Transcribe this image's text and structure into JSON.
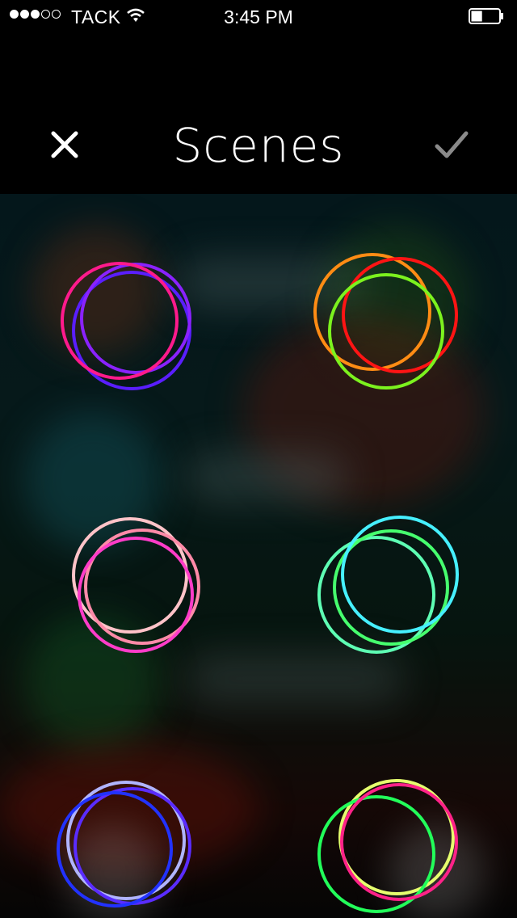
{
  "status_bar": {
    "carrier": "TACK",
    "time": "3:45 PM",
    "signal_bars_filled": 3,
    "signal_bars_total": 5,
    "battery_level": 0.4,
    "wifi_icon": "wifi-icon",
    "battery_icon": "battery-icon"
  },
  "nav": {
    "title": "Scenes",
    "close_icon": "close-icon",
    "confirm_icon": "checkmark-icon"
  },
  "scenes": [
    {
      "id": "scene-1",
      "colors": [
        "#5a1eff",
        "#8a22ff",
        "#ff1a8c"
      ]
    },
    {
      "id": "scene-2",
      "colors": [
        "#ff8c14",
        "#ff1414",
        "#7cf21e"
      ]
    },
    {
      "id": "scene-3",
      "colors": [
        "#ffc3c8",
        "#ff8aa8",
        "#ff3cc8"
      ]
    },
    {
      "id": "scene-4",
      "colors": [
        "#5effb4",
        "#46ff6e",
        "#46f0ff"
      ]
    },
    {
      "id": "scene-5",
      "colors": [
        "#b0b4ff",
        "#5a2cff",
        "#2232ff"
      ]
    },
    {
      "id": "scene-6",
      "colors": [
        "#e6ff6e",
        "#22ff5a",
        "#ff2288"
      ]
    }
  ]
}
